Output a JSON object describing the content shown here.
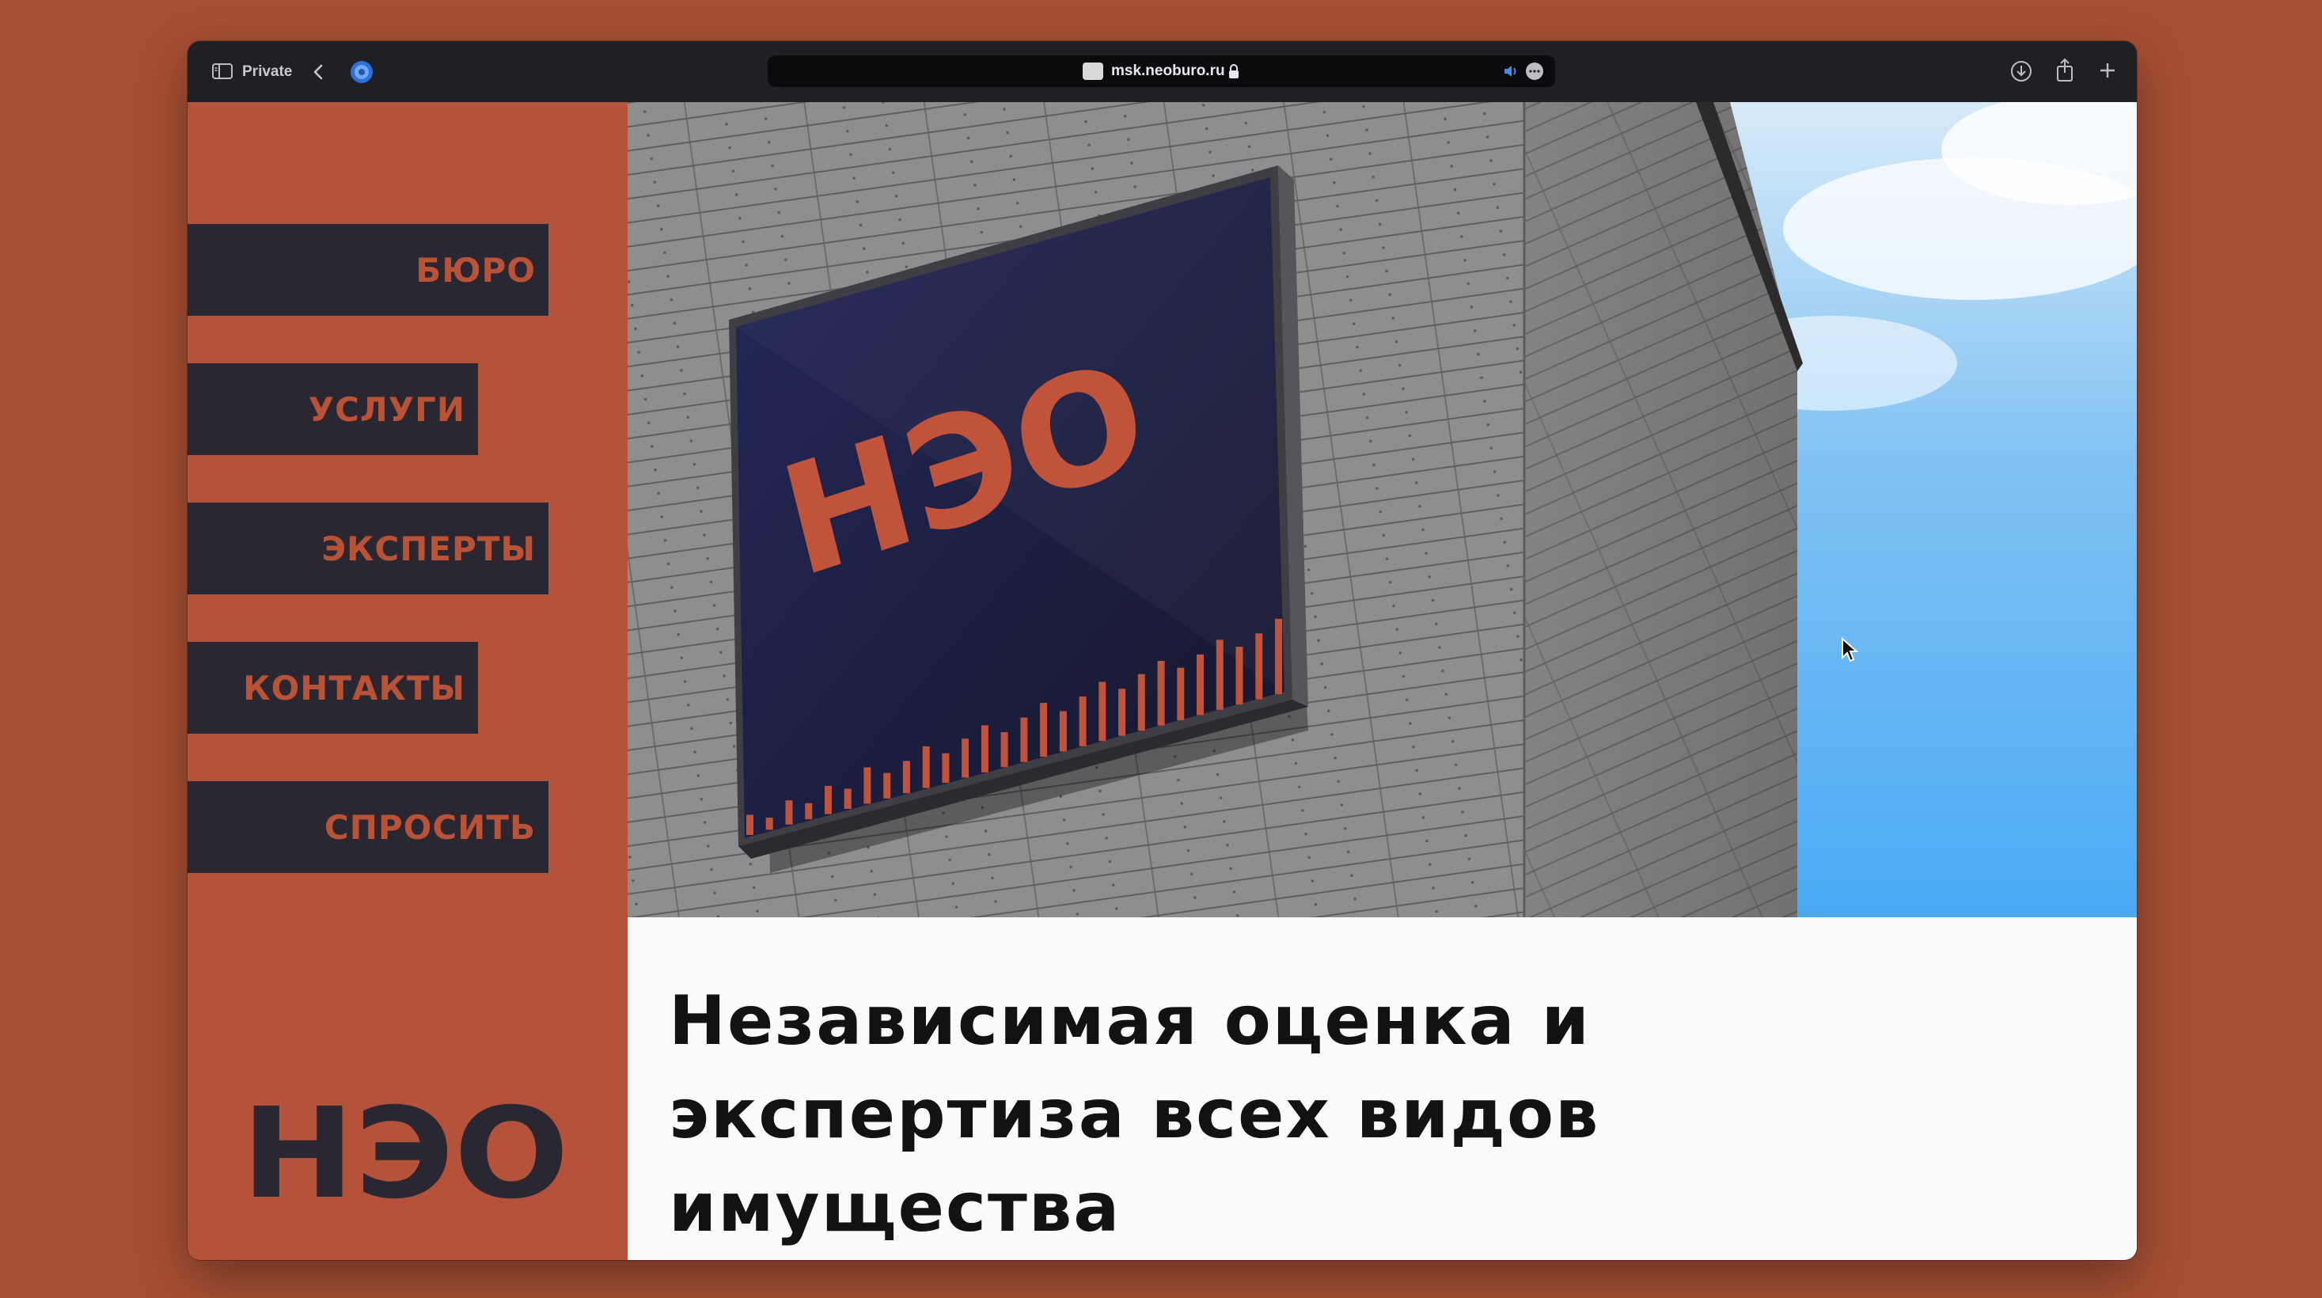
{
  "browser": {
    "private_label": "Private",
    "url": "msk.neoburo.ru"
  },
  "nav": {
    "items": [
      {
        "label": "БЮРО"
      },
      {
        "label": "УСЛУГИ"
      },
      {
        "label": "ЭКСПЕРТЫ"
      },
      {
        "label": "КОНТАКТЫ"
      },
      {
        "label": "СПРОСИТЬ"
      }
    ]
  },
  "brand": {
    "logo_text": "НЭО"
  },
  "hero": {
    "sign_text": "НЭО",
    "headline": "Независимая оценка и экспертиза всех видов имущества"
  },
  "colors": {
    "page_bg": "#A64F34",
    "sidebar": "#B5533A",
    "nav_button": "#2A2733",
    "nav_text": "#BA5235",
    "sign_navy": "#1D1F44",
    "accent": "#C0533A",
    "sky": "#4DAEF6"
  }
}
